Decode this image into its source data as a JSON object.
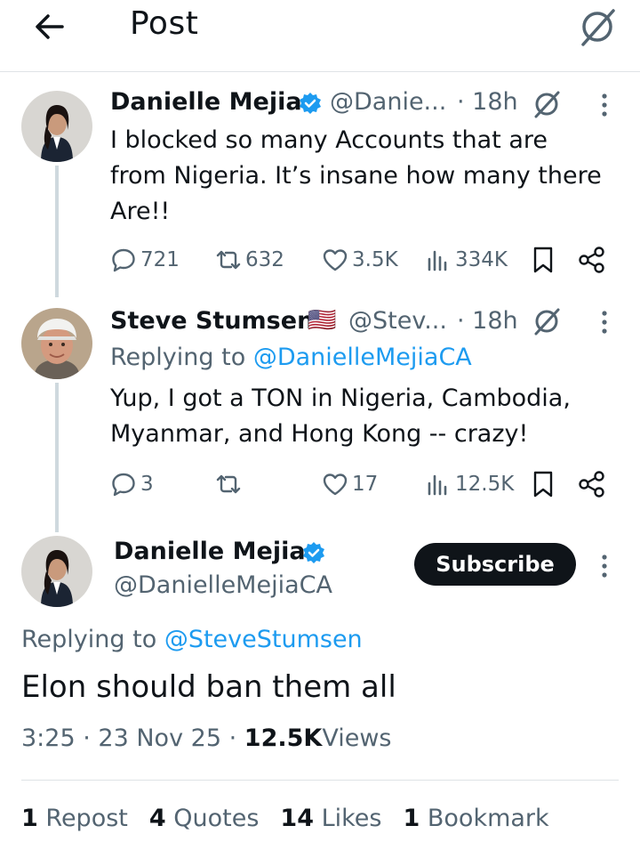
{
  "header": {
    "title": "Post",
    "back_icon": "arrow-left-icon",
    "grok_icon": "grok-icon"
  },
  "colors": {
    "link": "#1d9bf0",
    "verified": "#1d9bf0",
    "muted": "#536471",
    "text": "#0f1419"
  },
  "tweet1": {
    "name": "Danielle Mejia",
    "handle": "@Danie...",
    "time": "· 18h",
    "text_lines": [
      "I blocked so many Accounts that are",
      "from Nigeria. It’s insane how many there",
      "Are!!"
    ],
    "metrics": {
      "replies": "721",
      "reposts": "632",
      "likes": "3.5K",
      "views": "334K"
    }
  },
  "tweet2": {
    "name": "Steve Stumsen",
    "flag": "🇺🇸",
    "handle": "@Stev...",
    "time": "· 18h",
    "replying_prefix": "Replying to",
    "replying_handle": "@DanielleMejiaCA",
    "text_lines": [
      "Yup, I got a TON in Nigeria, Cambodia,",
      "Myanmar, and Hong Kong -- crazy!"
    ],
    "metrics": {
      "replies": "3",
      "reposts": "",
      "likes": "17",
      "views": "12.5K"
    }
  },
  "main": {
    "name": "Danielle Mejia",
    "handle": "@DanielleMejiaCA",
    "subscribe_label": "Subscribe",
    "replying_prefix": "Replying to",
    "replying_handle": "@SteveStumsen",
    "text": "Elon should ban them all",
    "time": "3:25",
    "date": "23 Nov 25",
    "views_count": "12.5K",
    "views_label": "Views",
    "sep": "·"
  },
  "stats": {
    "reposts_count": "1",
    "reposts_label": "Repost",
    "quotes_count": "4",
    "quotes_label": "Quotes",
    "likes_count": "14",
    "likes_label": "Likes",
    "bookmarks_count": "1",
    "bookmarks_label": "Bookmark"
  }
}
